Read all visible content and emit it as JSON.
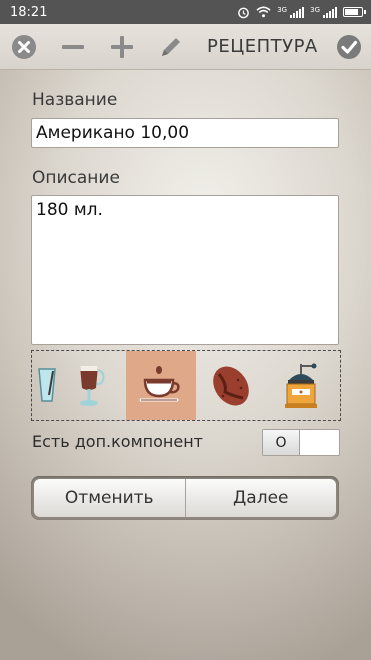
{
  "status_bar": {
    "time": "18:21",
    "network_1": "3G",
    "network_2": "3G"
  },
  "toolbar": {
    "title": "РЕЦЕПТУРА"
  },
  "form": {
    "name_label": "Название",
    "name_value": "Американо 10,00",
    "description_label": "Описание",
    "description_value": "180 мл.",
    "extra_component_label": "Есть доп.компонент",
    "extra_component_toggle": "O"
  },
  "icon_strip": {
    "items": [
      "glass-icon",
      "irish-coffee-icon",
      "coffee-cup-icon",
      "coffee-bean-icon",
      "coffee-grinder-icon"
    ],
    "selected_index": 2
  },
  "buttons": {
    "cancel": "Отменить",
    "next": "Далее"
  },
  "colors": {
    "selected_bg": "#dea889",
    "status_bar": "#545454"
  }
}
